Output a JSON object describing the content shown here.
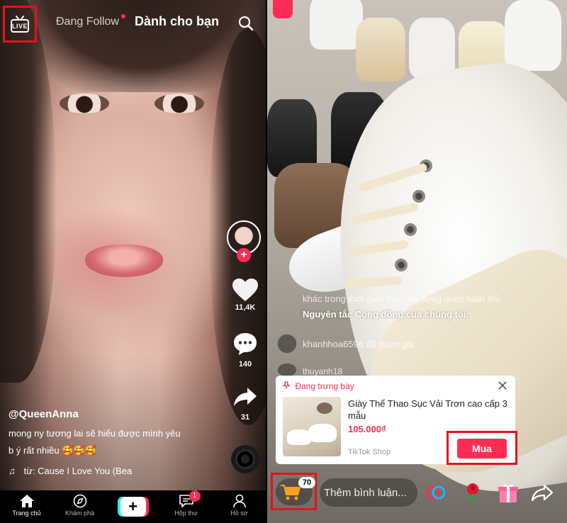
{
  "left_panel": {
    "header": {
      "live_label": "LIVE",
      "tab_following": "Đang Follow",
      "tab_for_you": "Dành cho bạn"
    },
    "side_actions": {
      "likes": "11,4K",
      "comments": "140",
      "shares": "31"
    },
    "post": {
      "username": "@QueenAnna",
      "caption_line1": "mong ny tương lai sẽ hiểu được mình yêu",
      "caption_line2": "b ý rất nhiều",
      "caption_emojis": "🥰🥰🥰",
      "music": "từ: Cause I Love You (Bea"
    },
    "bottom_nav": {
      "home": "Trang chủ",
      "discover": "Khám phá",
      "create": "+",
      "inbox": "Hộp thư",
      "inbox_badge": "1",
      "profile": "Hồ sơ"
    }
  },
  "right_panel": {
    "chat": {
      "line1": "khác trong thời gian thực và đừng quên tuân thủ",
      "line2": "Nguyên tắc Cộng đồng của chúng tôi.",
      "line3": "khanhhoa6596 đã tham gia",
      "line4": "thuyanh18"
    },
    "product_card": {
      "header": "Đang trưng bày",
      "title": "Giày Thể Thao Sục Vải Trơn cao cấp 3 mẫu",
      "price": "105.000₫",
      "shop": "TikTok Shop",
      "buy_label": "Mua"
    },
    "bottom_bar": {
      "cart_count": "70",
      "comment_placeholder": "Thêm bình luận..."
    }
  },
  "colors": {
    "accent": "#fe2c55",
    "highlight_frame": "#e4131d",
    "cyan": "#25f4ee"
  }
}
